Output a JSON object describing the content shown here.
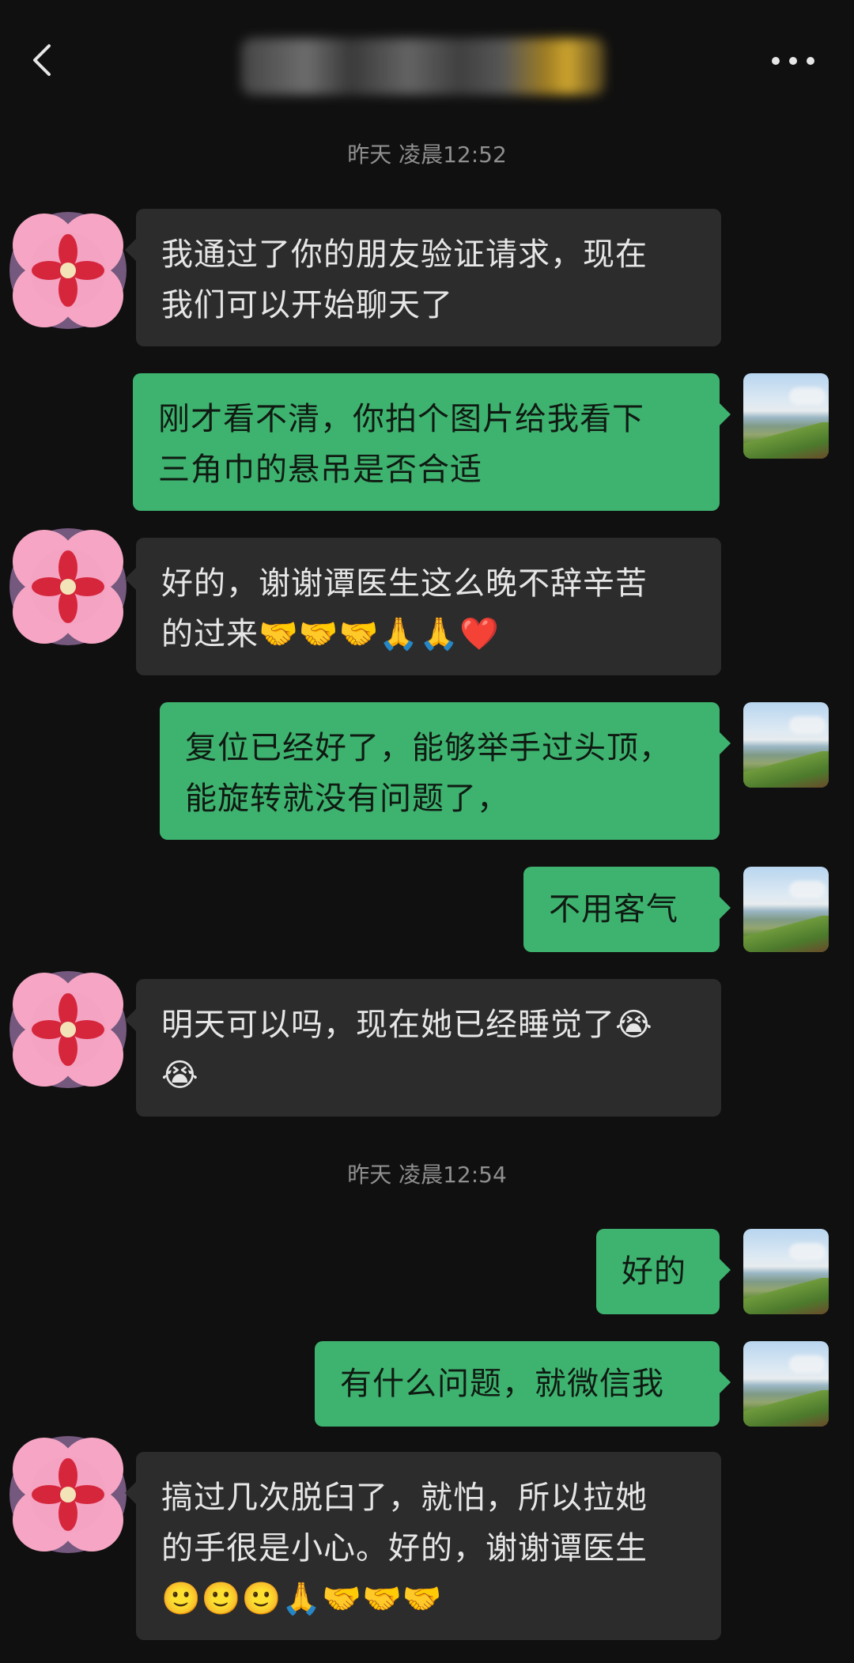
{
  "header": {
    "back_icon": "chevron-left-icon",
    "more_icon": "more-dots-icon"
  },
  "timestamps": [
    "昨天 凌晨12:52",
    "昨天 凌晨12:54"
  ],
  "messages": [
    {
      "side": "in",
      "text": "我通过了你的朋友验证请求，现在\n我们可以开始聊天了"
    },
    {
      "side": "out",
      "text": "刚才看不清，你拍个图片给我看下\n三角巾的悬吊是否合适"
    },
    {
      "side": "in",
      "text": "好的，谢谢谭医生这么晚不辞辛苦\n的过来🤝🤝🤝🙏🙏❤️"
    },
    {
      "side": "out",
      "text": "复位已经好了，能够举手过头顶，\n能旋转就没有问题了，"
    },
    {
      "side": "out",
      "text": "不用客气"
    },
    {
      "side": "in",
      "text": "明天可以吗，现在她已经睡觉了😭\n😭"
    },
    {
      "side": "out",
      "text": "好的"
    },
    {
      "side": "out",
      "text": "有什么问题，就微信我"
    },
    {
      "side": "in",
      "text": "搞过几次脱臼了，就怕，所以拉她\n的手很是小心。好的，谢谢谭医生\n🙂🙂🙂🙏🤝🤝🤝"
    }
  ],
  "colors": {
    "background": "#101010",
    "incoming_bubble": "#2c2c2c",
    "outgoing_bubble": "#3eb36f",
    "timestamp": "#8f8f8f"
  }
}
